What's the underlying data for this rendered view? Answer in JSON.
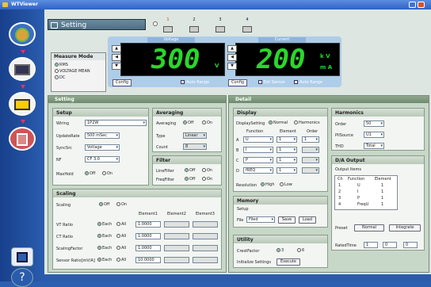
{
  "window": {
    "title": "WTViewer",
    "controls": [
      "minimize",
      "close"
    ]
  },
  "sidebar": {
    "icons": [
      "globe-icon",
      "monitor-icon",
      "monitor-icon",
      "chip-icon"
    ],
    "bottom": [
      "save-icon",
      "help-icon"
    ]
  },
  "header": {
    "tab_label": "Setting",
    "elements": [
      "1",
      "2",
      "3",
      "4"
    ]
  },
  "measure_mode": {
    "title": "Measure Mode",
    "options": [
      "RMS",
      "VOLTAGE MEAN",
      "DC"
    ],
    "selected": "RMS"
  },
  "voltage": {
    "label": "Voltage",
    "value": "300",
    "unit": "V",
    "config": "Config",
    "auto": "Auto Range"
  },
  "current": {
    "label": "Current",
    "value": "200",
    "unit_prefix": "k V",
    "unit_main": "m A",
    "config": "Config",
    "ext": "Ext Sensor",
    "auto": "Auto Range"
  },
  "setting": {
    "title": "Setting",
    "setup": {
      "title": "Setup",
      "wiring_label": "Wiring",
      "wiring": "1P2W",
      "update_label": "UpdateRate",
      "update": "500 mSec",
      "sync_label": "SyncSrc",
      "sync": "Voltage",
      "nf_label": "NF",
      "nf": "CF 3.0",
      "maxhold_label": "MaxHold",
      "off": "Off",
      "on": "On"
    },
    "averaging": {
      "title": "Averaging",
      "avg_label": "Averaging",
      "off": "Off",
      "on": "On",
      "type_label": "Type",
      "type": "Linear",
      "count_label": "Count",
      "count": "8"
    },
    "filter": {
      "title": "Filter",
      "line_label": "LineFilter",
      "freq_label": "FreqFilter",
      "off": "Off",
      "on": "On"
    },
    "scaling": {
      "title": "Scaling",
      "scaling_label": "Scaling",
      "off": "Off",
      "on": "On",
      "cols": [
        "Element1",
        "Element2",
        "Element3"
      ],
      "rows": [
        {
          "label": "VT Ratio",
          "each": "Each",
          "all": "All",
          "v": "1.0000"
        },
        {
          "label": "CT Ratio",
          "each": "Each",
          "all": "All",
          "v": "1.0000"
        },
        {
          "label": "ScalingFactor",
          "each": "Each",
          "all": "All",
          "v": "1.0000"
        },
        {
          "label": "Sensor Ratio[mV/A]",
          "each": "Each",
          "all": "All",
          "v": "10.0000"
        }
      ]
    }
  },
  "detail": {
    "title": "Detail",
    "display": {
      "title": "Display",
      "display_label": "DisplaySetting",
      "normal": "Normal",
      "harmonics": "Harmonics",
      "cols": [
        "Function",
        "Element",
        "Order"
      ],
      "rows": [
        {
          "k": "A",
          "f": "U",
          "e": "1",
          "o": "1"
        },
        {
          "k": "B",
          "f": "I",
          "e": "1",
          "o": ""
        },
        {
          "k": "C",
          "f": "P",
          "e": "1",
          "o": ""
        },
        {
          "k": "D",
          "f": "fREQ",
          "e": "1",
          "o": ""
        }
      ],
      "res_label": "Resolution",
      "high": "High",
      "low": "Low"
    },
    "memory": {
      "title": "Memory",
      "setup": "Setup",
      "file_label": "File",
      "file": "Filed",
      "save": "Save",
      "load": "Load"
    },
    "utility": {
      "title": "Utility",
      "crest_label": "CrestFactor",
      "c3": "3",
      "c6": "6",
      "init_label": "Initialize Settings",
      "execute": "Execute"
    },
    "harmonics": {
      "title": "Harmonics",
      "order_label": "Order",
      "order": "50",
      "src_label": "PllSource",
      "src": "U1",
      "thd_label": "THD",
      "thd": "Total"
    },
    "dva": {
      "title": "D/A Output",
      "items_label": "Output Items",
      "cols": [
        "Ch",
        "Function",
        "Element"
      ],
      "rows": [
        {
          "ch": "1",
          "f": "U",
          "e": "1"
        },
        {
          "ch": "2",
          "f": "I",
          "e": "1"
        },
        {
          "ch": "3",
          "f": "P",
          "e": "1"
        },
        {
          "ch": "4",
          "f": "FreqU",
          "e": "1"
        }
      ],
      "preset_label": "Preset",
      "normal": "Normal",
      "integrate": "Integrate",
      "rated_label": "RatedTime",
      "h": "1",
      "m": "0",
      "s": "0"
    }
  }
}
